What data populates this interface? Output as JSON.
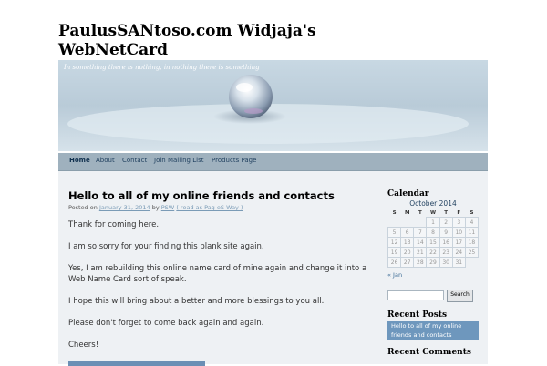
{
  "site": {
    "title": "PaulusSANtoso.com Widjaja's WebNetCard",
    "tagline": "In something there is nothing, in nothing there is something"
  },
  "nav": {
    "items": [
      {
        "label": "Home",
        "active": true
      },
      {
        "label": "About"
      },
      {
        "label": "Contact"
      },
      {
        "label": "Join Mailing List"
      },
      {
        "label": "Products Page"
      }
    ]
  },
  "post": {
    "title": "Hello to all of my online friends and contacts",
    "meta": {
      "posted_on": "Posted on",
      "date": "January 31, 2014",
      "by": "by",
      "author": "PSW",
      "read_link": "( read as Pag eS Way )"
    },
    "paragraphs": [
      "Thank for coming here.",
      "I am so sorry for your finding this blank site again.",
      "Yes, I am rebuilding this online name card of mine again and change it into a Web Name Card sort of speak.",
      "I hope this will bring about a better and more blessings to you all.",
      "Please don't forget to come back again and again.",
      "Cheers!"
    ]
  },
  "sidebar": {
    "calendar": {
      "title": "Calendar",
      "caption": "October 2014",
      "weekdays": [
        "S",
        "M",
        "T",
        "W",
        "T",
        "F",
        "S"
      ],
      "weeks": [
        [
          "",
          "",
          "",
          "1",
          "2",
          "3",
          "4"
        ],
        [
          "5",
          "6",
          "7",
          "8",
          "9",
          "10",
          "11"
        ],
        [
          "12",
          "13",
          "14",
          "15",
          "16",
          "17",
          "18"
        ],
        [
          "19",
          "20",
          "21",
          "22",
          "23",
          "24",
          "25"
        ],
        [
          "26",
          "27",
          "28",
          "29",
          "30",
          "31",
          ""
        ]
      ],
      "prev_link": "« Jan"
    },
    "search": {
      "button": "Search",
      "value": ""
    },
    "recent_posts": {
      "title": "Recent Posts",
      "items": [
        "Hello to all of my online friends and contacts"
      ]
    },
    "recent_comments": {
      "title": "Recent Comments"
    }
  },
  "colors": {
    "nav_bg": "#9fb1be",
    "page_bg": "#eef1f4",
    "accent": "#6e97bd",
    "link": "#7a9bb6"
  }
}
